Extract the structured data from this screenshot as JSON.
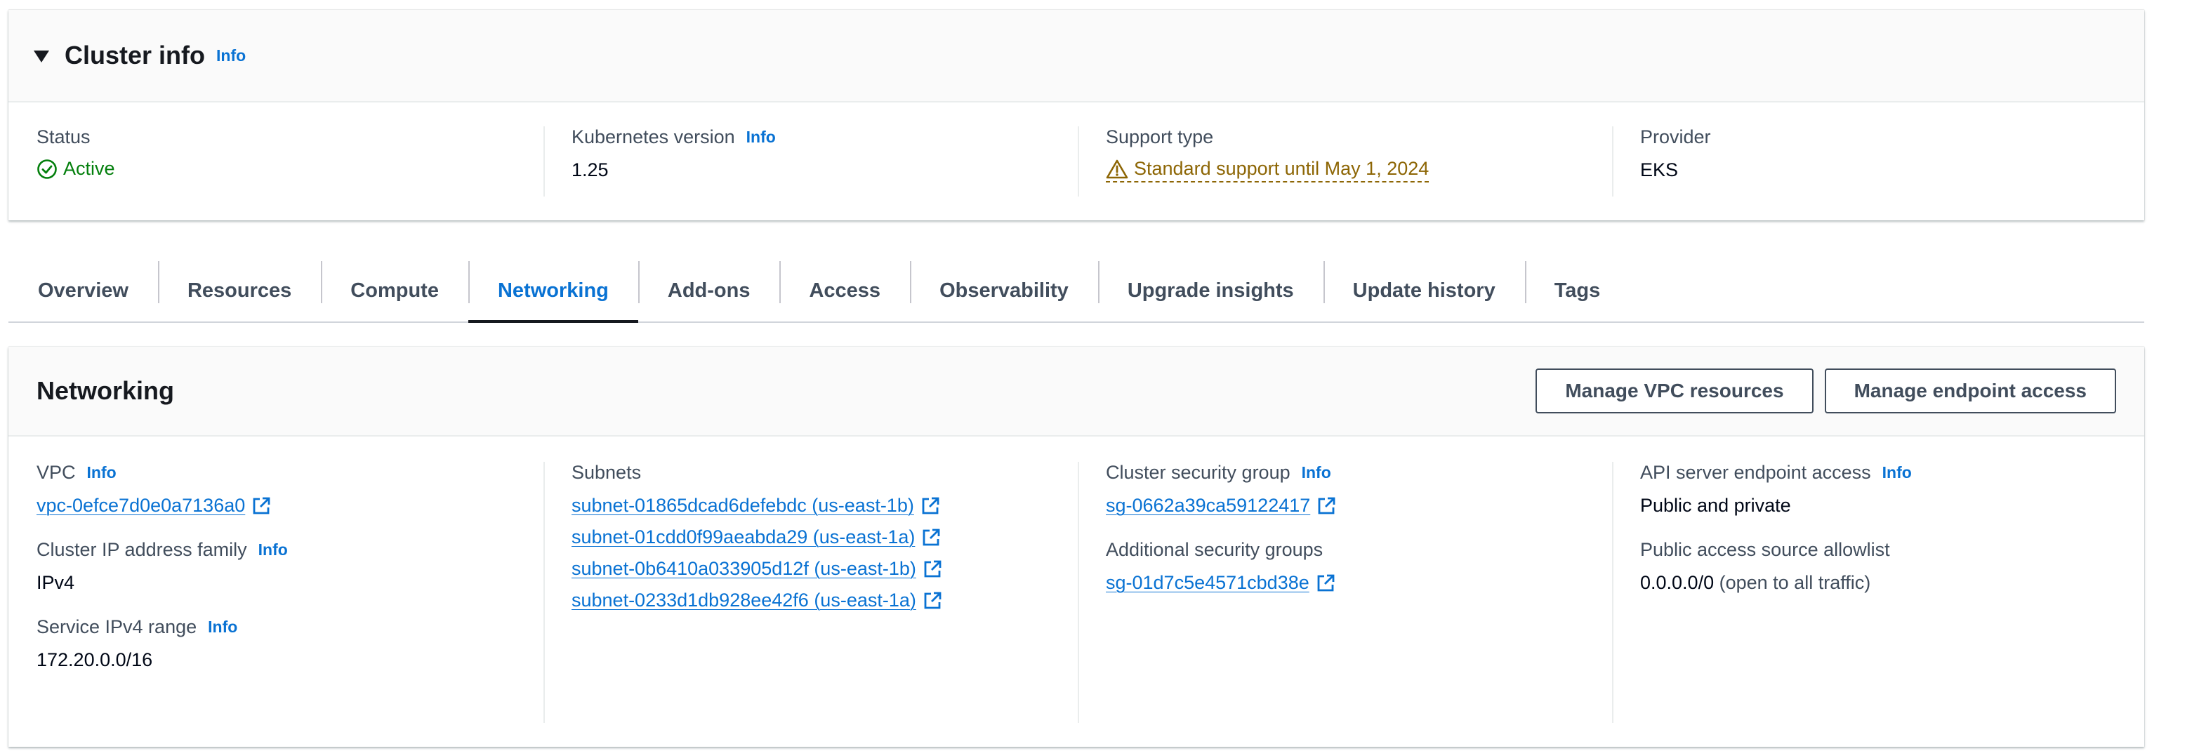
{
  "cluster_info": {
    "title": "Cluster info",
    "info": "Info",
    "status_label": "Status",
    "status_value": "Active",
    "k8s_label": "Kubernetes version",
    "k8s_value": "1.25",
    "support_label": "Support type",
    "support_value": "Standard support until May 1, 2024",
    "provider_label": "Provider",
    "provider_value": "EKS"
  },
  "tabs": [
    {
      "label": "Overview"
    },
    {
      "label": "Resources"
    },
    {
      "label": "Compute"
    },
    {
      "label": "Networking"
    },
    {
      "label": "Add-ons"
    },
    {
      "label": "Access"
    },
    {
      "label": "Observability"
    },
    {
      "label": "Upgrade insights"
    },
    {
      "label": "Update history"
    },
    {
      "label": "Tags"
    }
  ],
  "active_tab": "Networking",
  "networking": {
    "title": "Networking",
    "manage_vpc_label": "Manage VPC resources",
    "manage_endpoint_label": "Manage endpoint access",
    "info": "Info",
    "vpc_label": "VPC",
    "vpc_value": "vpc-0efce7d0e0a7136a0",
    "ip_family_label": "Cluster IP address family",
    "ip_family_value": "IPv4",
    "service_range_label": "Service IPv4 range",
    "service_range_value": "172.20.0.0/16",
    "subnets_label": "Subnets",
    "subnets": [
      "subnet-01865dcad6defebdc (us-east-1b)",
      "subnet-01cdd0f99aeabda29 (us-east-1a)",
      "subnet-0b6410a033905d12f (us-east-1b)",
      "subnet-0233d1db928ee42f6 (us-east-1a)"
    ],
    "cluster_sg_label": "Cluster security group",
    "cluster_sg_value": "sg-0662a39ca59122417",
    "additional_sg_label": "Additional security groups",
    "additional_sg_value": "sg-01d7c5e4571cbd38e",
    "endpoint_access_label": "API server endpoint access",
    "endpoint_access_value": "Public and private",
    "allowlist_label": "Public access source allowlist",
    "allowlist_cidr": "0.0.0.0/0",
    "allowlist_note": "(open to all traffic)"
  },
  "colors": {
    "link": "#0972d3",
    "success": "#037f0c",
    "warning": "#8d6605",
    "text": "#16191f",
    "label": "#414d5c"
  }
}
